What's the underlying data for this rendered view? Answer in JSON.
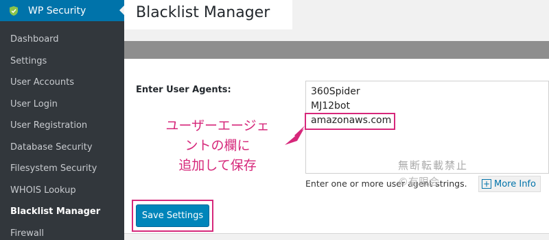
{
  "sidebar": {
    "heading": "WP Security",
    "items": [
      {
        "label": "Dashboard"
      },
      {
        "label": "Settings"
      },
      {
        "label": "User Accounts"
      },
      {
        "label": "User Login"
      },
      {
        "label": "User Registration"
      },
      {
        "label": "Database Security"
      },
      {
        "label": "Filesystem Security"
      },
      {
        "label": "WHOIS Lookup"
      },
      {
        "label": "Blacklist Manager",
        "current": true
      },
      {
        "label": "Firewall"
      }
    ]
  },
  "page": {
    "title": "Blacklist Manager"
  },
  "form": {
    "user_agents_label": "Enter User Agents:",
    "user_agents": [
      "360Spider",
      "MJ12bot",
      "amazonaws.com"
    ],
    "help_text": "Enter one or more user agent strings.",
    "more_info_label": "More Info",
    "save_label": "Save Settings"
  },
  "annotation": {
    "lines": [
      "ユーザーエージェ",
      "ントの欄に",
      "追加して保存"
    ],
    "watermark": "無断転載禁止",
    "copyright": "©有限会"
  },
  "colors": {
    "accent_pink": "#d6277a",
    "wp_blue": "#0073aa",
    "button_blue": "#0085ba"
  },
  "icons": {
    "menu_icon": "shield-icon",
    "more_info_icon": "plus-icon"
  }
}
